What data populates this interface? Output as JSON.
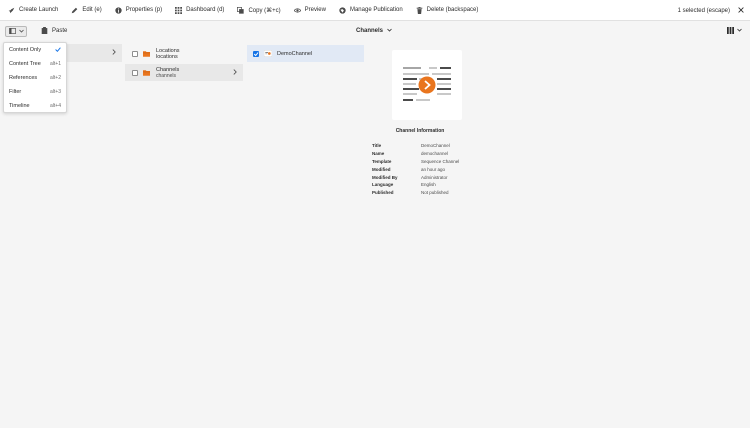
{
  "toolbar": {
    "items": [
      {
        "label": "Create Launch",
        "icon": "rocket-icon"
      },
      {
        "label": "Edit (e)",
        "icon": "pencil-icon"
      },
      {
        "label": "Properties (p)",
        "icon": "info-icon"
      },
      {
        "label": "Dashboard (d)",
        "icon": "grid-icon"
      },
      {
        "label": "Copy (⌘+c)",
        "icon": "copy-icon"
      },
      {
        "label": "Preview",
        "icon": "eye-icon"
      },
      {
        "label": "Manage Publication",
        "icon": "globe-icon"
      },
      {
        "label": "Delete (backspace)",
        "icon": "trash-icon"
      }
    ],
    "selection_status": "1 selected (escape)",
    "close_icon": "close-icon"
  },
  "subbar": {
    "rail_toggle_icon": "panel-icon",
    "paste_label": "Paste",
    "paste_icon": "clipboard-icon",
    "title": "Channels",
    "view_switch_icon": "column-view-icon"
  },
  "rail_menu": {
    "items": [
      {
        "label": "Content Only",
        "shortcut": "",
        "selected": true
      },
      {
        "label": "Content Tree",
        "shortcut": "alt+1",
        "selected": false
      },
      {
        "label": "References",
        "shortcut": "alt+2",
        "selected": false
      },
      {
        "label": "Filter",
        "shortcut": "alt+3",
        "selected": false
      },
      {
        "label": "Timeline",
        "shortcut": "alt+4",
        "selected": false
      }
    ]
  },
  "column1": {
    "rows": [
      {
        "title": "Locations",
        "name": "locations",
        "selected": false
      },
      {
        "title": "Channels",
        "name": "channels",
        "selected": true
      }
    ]
  },
  "column2": {
    "rows": [
      {
        "title": "DemoChannel",
        "checked": true
      }
    ]
  },
  "details": {
    "heading": "Channel Information",
    "fields": [
      {
        "key": "Title",
        "value": "DemoChannel"
      },
      {
        "key": "Name",
        "value": "demochannel"
      },
      {
        "key": "Template",
        "value": "Sequence Channel"
      },
      {
        "key": "Modified",
        "value": "an hour ago"
      },
      {
        "key": "Modified By",
        "value": "Administrator"
      },
      {
        "key": "Language",
        "value": "English"
      },
      {
        "key": "Published",
        "value": "Not published"
      }
    ]
  },
  "colors": {
    "accent": "#1473e6",
    "folder": "#e9751e",
    "play": "#e9751e",
    "selected_row": "#e1e9f5"
  }
}
